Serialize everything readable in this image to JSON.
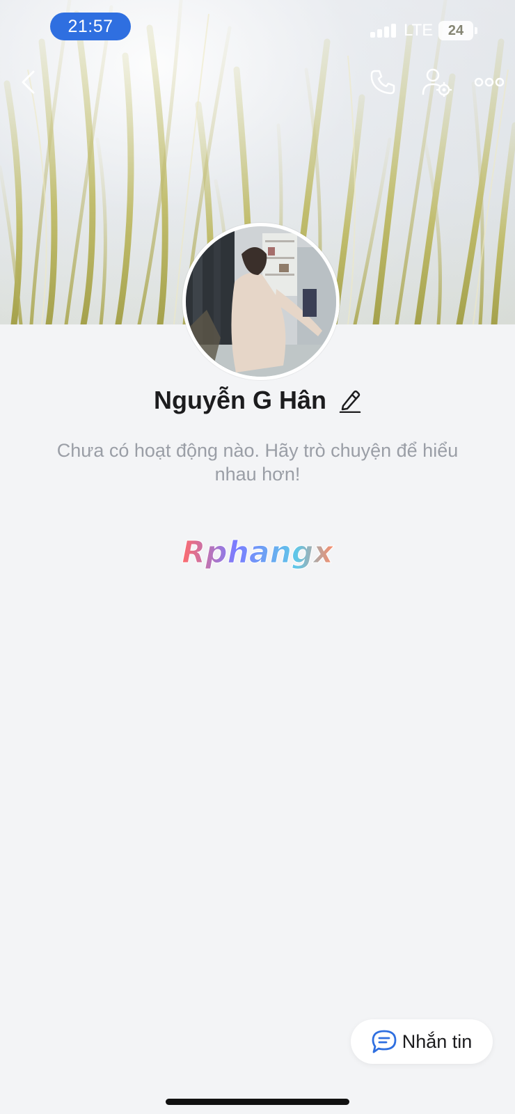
{
  "status_bar": {
    "time": "21:57",
    "network": "LTE",
    "battery": "24"
  },
  "profile": {
    "name": "Nguyễn G Hân",
    "activity_text": "Chưa có hoạt động nào. Hãy trò chuyện để hiểu nhau hơn!",
    "watermark_text": "Rphangx"
  },
  "header_icons": [
    "back-icon",
    "phone-icon",
    "person-settings-icon",
    "more-icon"
  ],
  "actions": {
    "message_label": "Nhắn tin"
  },
  "colors": {
    "time_pill": "#2f6fe0",
    "background": "#f3f4f6",
    "message_icon": "#2f6fe0"
  }
}
